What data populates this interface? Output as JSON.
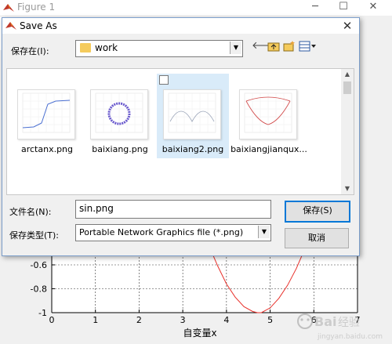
{
  "figure": {
    "title": "Figure 1",
    "controls": {
      "minimize": "─",
      "maximize": "☐",
      "close": "✕"
    }
  },
  "dialog": {
    "title": "Save As",
    "close": "✕",
    "save_in_label": "保存在(I):",
    "save_in_value": "work",
    "toolbar_icons": [
      "back-arrow-icon",
      "up-folder-icon",
      "new-folder-icon",
      "view-menu-icon"
    ],
    "files": [
      {
        "name": "arctanx.png",
        "selected": false
      },
      {
        "name": "baixiang.png",
        "selected": false
      },
      {
        "name": "baixiang2.png",
        "selected": true
      },
      {
        "name": "baixiangjianqux...",
        "selected": false
      }
    ],
    "filename_label": "文件名(N):",
    "filename_value": "sin.png",
    "filetype_label": "保存类型(T):",
    "filetype_value": "Portable Network Graphics file (*.png)",
    "save_button": "保存(S)",
    "cancel_button": "取消"
  },
  "chart_data": {
    "type": "line",
    "xlabel": "自变量x",
    "ylabel": "",
    "title": "",
    "xlim": [
      0,
      7
    ],
    "ylim": [
      -1,
      -0.4
    ],
    "xticks": [
      "0",
      "1",
      "2",
      "3",
      "4",
      "5",
      "6",
      "7"
    ],
    "yticks": [
      "-0.6",
      "-0.8",
      "-1"
    ],
    "grid": true,
    "series": [
      {
        "color": "#e8302a",
        "x": [
          3.6,
          3.8,
          4.0,
          4.2,
          4.4,
          4.6,
          4.71,
          4.8,
          5.0,
          5.2,
          5.4,
          5.6,
          5.8
        ],
        "y": [
          -0.44,
          -0.61,
          -0.76,
          -0.87,
          -0.95,
          -0.99,
          -1.0,
          -1.0,
          -0.96,
          -0.88,
          -0.77,
          -0.63,
          -0.46
        ]
      }
    ]
  },
  "watermark": {
    "brand": "Baidu经验",
    "url": "jingyan.baidu.com"
  }
}
